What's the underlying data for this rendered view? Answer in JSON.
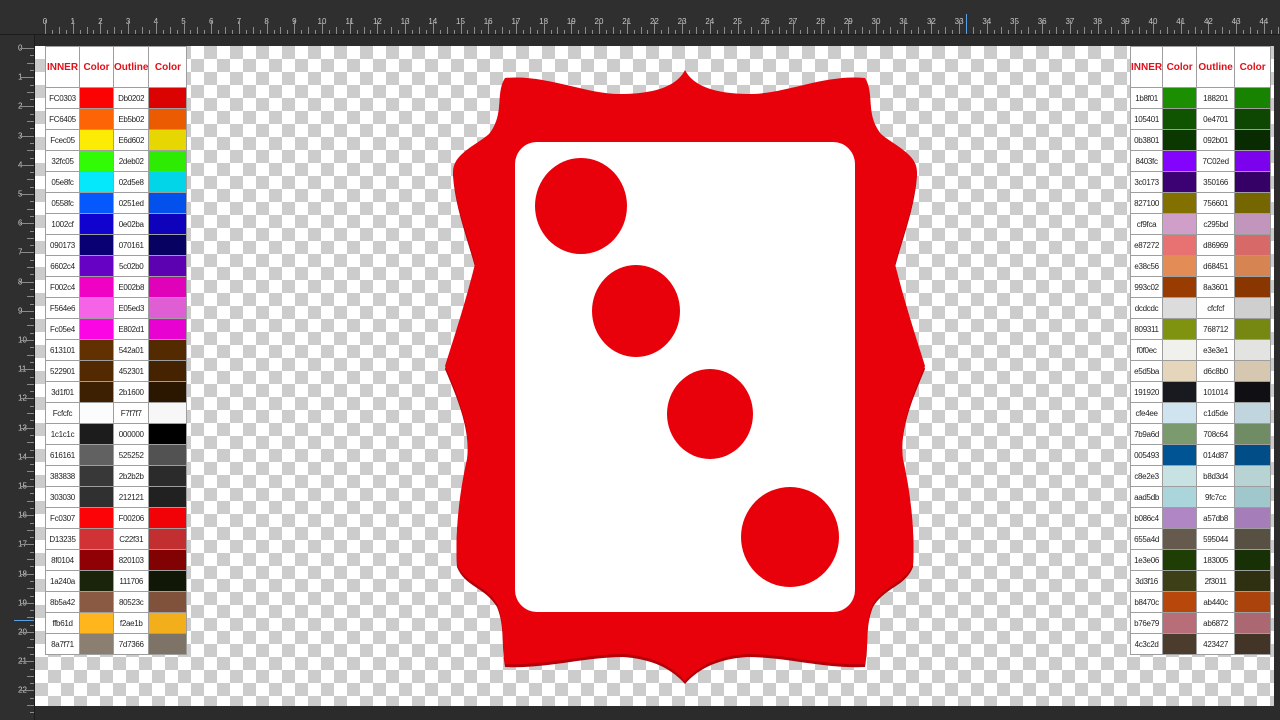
{
  "ruler": {
    "top_labels": [
      "0",
      "1",
      "2",
      "3",
      "4",
      "5",
      "6",
      "7",
      "8",
      "9",
      "10",
      "11",
      "12",
      "13",
      "14",
      "15",
      "16",
      "17",
      "18",
      "19",
      "20",
      "21",
      "22",
      "23",
      "24",
      "25",
      "26",
      "27",
      "28",
      "29",
      "30",
      "31",
      "32",
      "33",
      "34",
      "35",
      "36",
      "37",
      "38",
      "39",
      "40",
      "41",
      "42",
      "43",
      "44"
    ],
    "left_labels": [
      "0",
      "1",
      "2",
      "3",
      "4",
      "5",
      "6",
      "7",
      "8",
      "9",
      "10",
      "11",
      "12",
      "13",
      "14",
      "15",
      "16",
      "17",
      "18",
      "19",
      "20",
      "21",
      "22"
    ]
  },
  "left_palette": {
    "headers": [
      "INNER",
      "Color",
      "Outline",
      "Color"
    ],
    "rows": [
      {
        "inner": "FC0303",
        "inner_color": "#fc0303",
        "outline": "Db0202",
        "outline_color": "#db0202"
      },
      {
        "inner": "FC6405",
        "inner_color": "#fc6405",
        "outline": "Eb5b02",
        "outline_color": "#eb5b02"
      },
      {
        "inner": "Fcec05",
        "inner_color": "#fcec05",
        "outline": "E6d602",
        "outline_color": "#e6d602"
      },
      {
        "inner": "32fc05",
        "inner_color": "#32fc05",
        "outline": "2deb02",
        "outline_color": "#2deb02"
      },
      {
        "inner": "05e8fc",
        "inner_color": "#05e8fc",
        "outline": "02d5e8",
        "outline_color": "#02d5e8"
      },
      {
        "inner": "0558fc",
        "inner_color": "#0558fc",
        "outline": "0251ed",
        "outline_color": "#0251ed"
      },
      {
        "inner": "1002cf",
        "inner_color": "#1002cf",
        "outline": "0e02ba",
        "outline_color": "#0e02ba"
      },
      {
        "inner": "090173",
        "inner_color": "#090173",
        "outline": "070161",
        "outline_color": "#070161"
      },
      {
        "inner": "6602c4",
        "inner_color": "#6602c4",
        "outline": "5c02b0",
        "outline_color": "#5c02b0"
      },
      {
        "inner": "F002c4",
        "inner_color": "#f002c4",
        "outline": "E002b8",
        "outline_color": "#e002b8"
      },
      {
        "inner": "F564e6",
        "inner_color": "#f564e6",
        "outline": "E05ed3",
        "outline_color": "#e05ed3"
      },
      {
        "inner": "Fc05e4",
        "inner_color": "#fc05e4",
        "outline": "E802d1",
        "outline_color": "#e802d1"
      },
      {
        "inner": "613101",
        "inner_color": "#613101",
        "outline": "542a01",
        "outline_color": "#542a01"
      },
      {
        "inner": "522901",
        "inner_color": "#522901",
        "outline": "452301",
        "outline_color": "#452301"
      },
      {
        "inner": "3d1f01",
        "inner_color": "#3d1f01",
        "outline": "2b1600",
        "outline_color": "#2b1600"
      },
      {
        "inner": "Fcfcfc",
        "inner_color": "#fcfcfc",
        "outline": "F7f7f7",
        "outline_color": "#f7f7f7"
      },
      {
        "inner": "1c1c1c",
        "inner_color": "#1c1c1c",
        "outline": "000000",
        "outline_color": "#000000"
      },
      {
        "inner": "616161",
        "inner_color": "#616161",
        "outline": "525252",
        "outline_color": "#525252"
      },
      {
        "inner": "383838",
        "inner_color": "#383838",
        "outline": "2b2b2b",
        "outline_color": "#2b2b2b"
      },
      {
        "inner": "303030",
        "inner_color": "#303030",
        "outline": "212121",
        "outline_color": "#212121"
      },
      {
        "inner": "Fc0307",
        "inner_color": "#fc0307",
        "outline": "F00206",
        "outline_color": "#f00206"
      },
      {
        "inner": "D13235",
        "inner_color": "#d13235",
        "outline": "C22f31",
        "outline_color": "#c22f31"
      },
      {
        "inner": "8f0104",
        "inner_color": "#8f0104",
        "outline": "820103",
        "outline_color": "#820103"
      },
      {
        "inner": "1a240a",
        "inner_color": "#1a240a",
        "outline": "111706",
        "outline_color": "#111706"
      },
      {
        "inner": "8b5a42",
        "inner_color": "#8b5a42",
        "outline": "80523c",
        "outline_color": "#80523c"
      },
      {
        "inner": "ffb61d",
        "inner_color": "#ffb61d",
        "outline": "f2ae1b",
        "outline_color": "#f2ae1b"
      },
      {
        "inner": "8a7f71",
        "inner_color": "#8a7f71",
        "outline": "7d7366",
        "outline_color": "#7d7366"
      }
    ]
  },
  "right_palette": {
    "headers": [
      "INNER",
      "Color",
      "Outline",
      "Color"
    ],
    "rows": [
      {
        "inner": "1b8f01",
        "inner_color": "#1b8f01",
        "outline": "188201",
        "outline_color": "#188201"
      },
      {
        "inner": "105401",
        "inner_color": "#105401",
        "outline": "0e4701",
        "outline_color": "#0e4701"
      },
      {
        "inner": "0b3801",
        "inner_color": "#0b3801",
        "outline": "092b01",
        "outline_color": "#092b01"
      },
      {
        "inner": "8403fc",
        "inner_color": "#8403fc",
        "outline": "7C02ed",
        "outline_color": "#7c02ed"
      },
      {
        "inner": "3c0173",
        "inner_color": "#3c0173",
        "outline": "350166",
        "outline_color": "#350166"
      },
      {
        "inner": "827100",
        "inner_color": "#827100",
        "outline": "756601",
        "outline_color": "#756601"
      },
      {
        "inner": "cf9fca",
        "inner_color": "#cf9fca",
        "outline": "c295bd",
        "outline_color": "#c295bd"
      },
      {
        "inner": "e87272",
        "inner_color": "#e87272",
        "outline": "d86969",
        "outline_color": "#d86969"
      },
      {
        "inner": "e38c56",
        "inner_color": "#e38c56",
        "outline": "d68451",
        "outline_color": "#d68451"
      },
      {
        "inner": "993c02",
        "inner_color": "#993c02",
        "outline": "8a3601",
        "outline_color": "#8a3601"
      },
      {
        "inner": "dcdcdc",
        "inner_color": "#dcdcdc",
        "outline": "cfcfcf",
        "outline_color": "#cfcfcf"
      },
      {
        "inner": "809311",
        "inner_color": "#809311",
        "outline": "768712",
        "outline_color": "#768712"
      },
      {
        "inner": "f0f0ec",
        "inner_color": "#f0f0ec",
        "outline": "e3e3e1",
        "outline_color": "#e3e3e1"
      },
      {
        "inner": "e5d5ba",
        "inner_color": "#e5d5ba",
        "outline": "d6c8b0",
        "outline_color": "#d6c8b0"
      },
      {
        "inner": "191920",
        "inner_color": "#191920",
        "outline": "101014",
        "outline_color": "#101014"
      },
      {
        "inner": "cfe4ee",
        "inner_color": "#cfe4ee",
        "outline": "c1d5de",
        "outline_color": "#c1d5de"
      },
      {
        "inner": "7b9a6d",
        "inner_color": "#7b9a6d",
        "outline": "708c64",
        "outline_color": "#708c64"
      },
      {
        "inner": "005493",
        "inner_color": "#005493",
        "outline": "014d87",
        "outline_color": "#014d87"
      },
      {
        "inner": "c8e2e3",
        "inner_color": "#c8e2e3",
        "outline": "b8d3d4",
        "outline_color": "#b8d3d4"
      },
      {
        "inner": "aad5db",
        "inner_color": "#aad5db",
        "outline": "9fc7cc",
        "outline_color": "#9fc7cc"
      },
      {
        "inner": "b086c4",
        "inner_color": "#b086c4",
        "outline": "a57db8",
        "outline_color": "#a57db8"
      },
      {
        "inner": "655a4d",
        "inner_color": "#655a4d",
        "outline": "595044",
        "outline_color": "#595044"
      },
      {
        "inner": "1e3e06",
        "inner_color": "#1e3e06",
        "outline": "183005",
        "outline_color": "#183005"
      },
      {
        "inner": "3d3f16",
        "inner_color": "#3d3f16",
        "outline": "2f3011",
        "outline_color": "#2f3011"
      },
      {
        "inner": "b8470c",
        "inner_color": "#b8470c",
        "outline": "ab440c",
        "outline_color": "#ab440c"
      },
      {
        "inner": "b76e79",
        "inner_color": "#b76e79",
        "outline": "ab6872",
        "outline_color": "#ab6872"
      },
      {
        "inner": "4c3c2d",
        "inner_color": "#4c3c2d",
        "outline": "423427",
        "outline_color": "#423427"
      }
    ]
  },
  "design": {
    "frame_color": "#e8000a",
    "frame_shadow": "#b40008",
    "card_color": "#ffffff",
    "pip_color": "#e8000a",
    "pip_count": 4
  }
}
